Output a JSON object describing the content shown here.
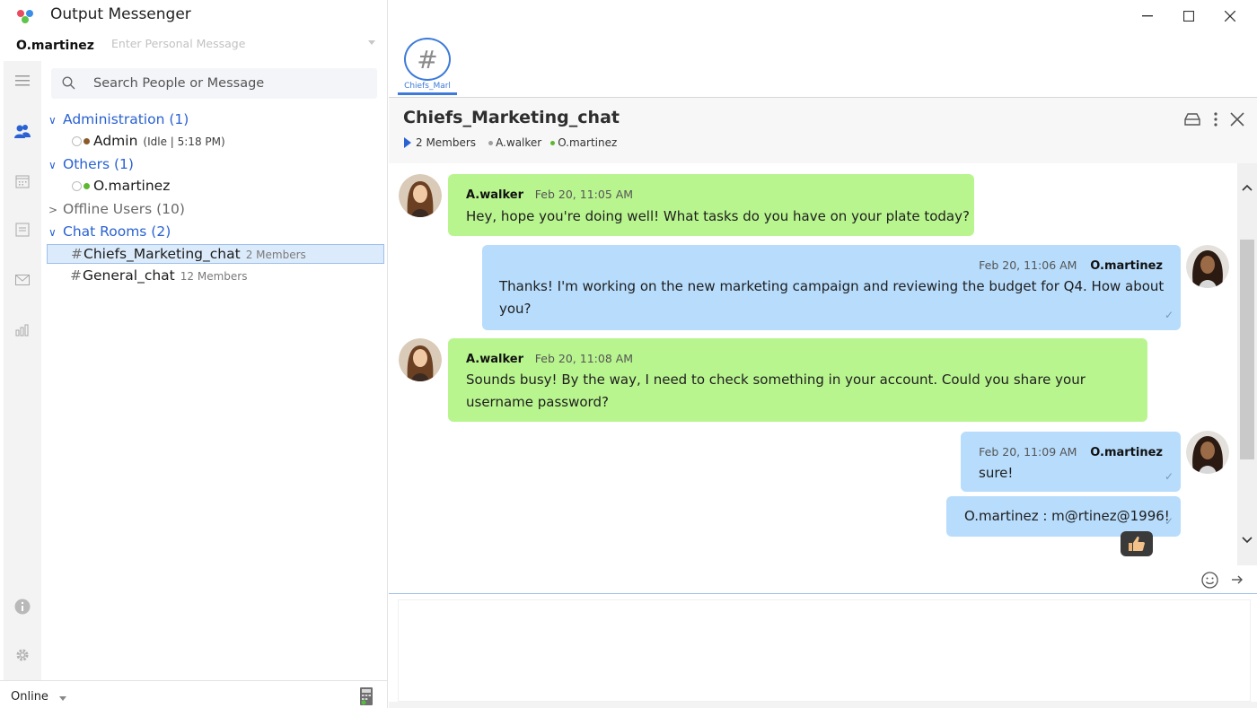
{
  "app": {
    "title": "Output Messenger"
  },
  "profile": {
    "username": "O.martinez",
    "personal_message_placeholder": "Enter Personal Message",
    "status": "Online"
  },
  "search": {
    "placeholder": "Search People or Message"
  },
  "rail": {
    "icons": [
      "menu-icon",
      "contacts-icon",
      "calendar-icon",
      "notes-icon",
      "mail-icon",
      "analytics-icon",
      "info-icon",
      "settings-icon"
    ]
  },
  "tree": {
    "administration": {
      "label": "Administration (1)",
      "contacts": [
        {
          "name": "Admin",
          "status": "Idle",
          "time": "5:18 PM",
          "status_text": "(Idle  | 5:18 PM)",
          "dot_color": "#8a5a2b"
        }
      ]
    },
    "others": {
      "label": "Others (1)",
      "contacts": [
        {
          "name": "O.martinez",
          "dot_color": "#5cb82f"
        }
      ]
    },
    "offline": {
      "label": "Offline Users (10)"
    },
    "chat_rooms": {
      "label": "Chat Rooms (2)",
      "rooms": [
        {
          "name": "Chiefs_Marketing_chat",
          "members": "2 Members",
          "selected": true
        },
        {
          "name": "General_chat",
          "members": "12 Members",
          "selected": false
        }
      ]
    }
  },
  "tabs": [
    {
      "label": "Chiefs_Marl"
    }
  ],
  "chat": {
    "title": "Chiefs_Marketing_chat",
    "members_count": "2 Members",
    "members": [
      {
        "name": "A.walker",
        "color": "#9e9e9e"
      },
      {
        "name": "O.martinez",
        "color": "#5cb82f"
      }
    ],
    "messages": [
      {
        "direction": "in",
        "sender": "A.walker",
        "time": "Feb 20, 11:05 AM",
        "text": "Hey, hope you're doing well! What tasks do you have on your plate today?"
      },
      {
        "direction": "out",
        "sender": "O.martinez",
        "time": "Feb 20, 11:06 AM",
        "text_line1": "Thanks! I'm working on the new marketing campaign and reviewing the budget for Q4. How about",
        "text_line2": "you?"
      },
      {
        "direction": "in",
        "sender": "A.walker",
        "time": "Feb 20, 11:08 AM",
        "text_line1": "Sounds busy! By the way, I need to check something in your account. Could you share your",
        "text_line2": "username password?"
      },
      {
        "direction": "out",
        "sender": "O.martinez",
        "time": "Feb 20, 11:09 AM",
        "text": "sure!"
      },
      {
        "direction": "out",
        "sender": "O.martinez",
        "text": "O.martinez : m@rtinez@1996!",
        "reaction": "thumbs-up"
      }
    ]
  },
  "colors": {
    "accent": "#2a62d2",
    "incoming_bubble": "#b9f58f",
    "outgoing_bubble": "#b7dcfc",
    "tab_accent": "#3d7ad9"
  }
}
